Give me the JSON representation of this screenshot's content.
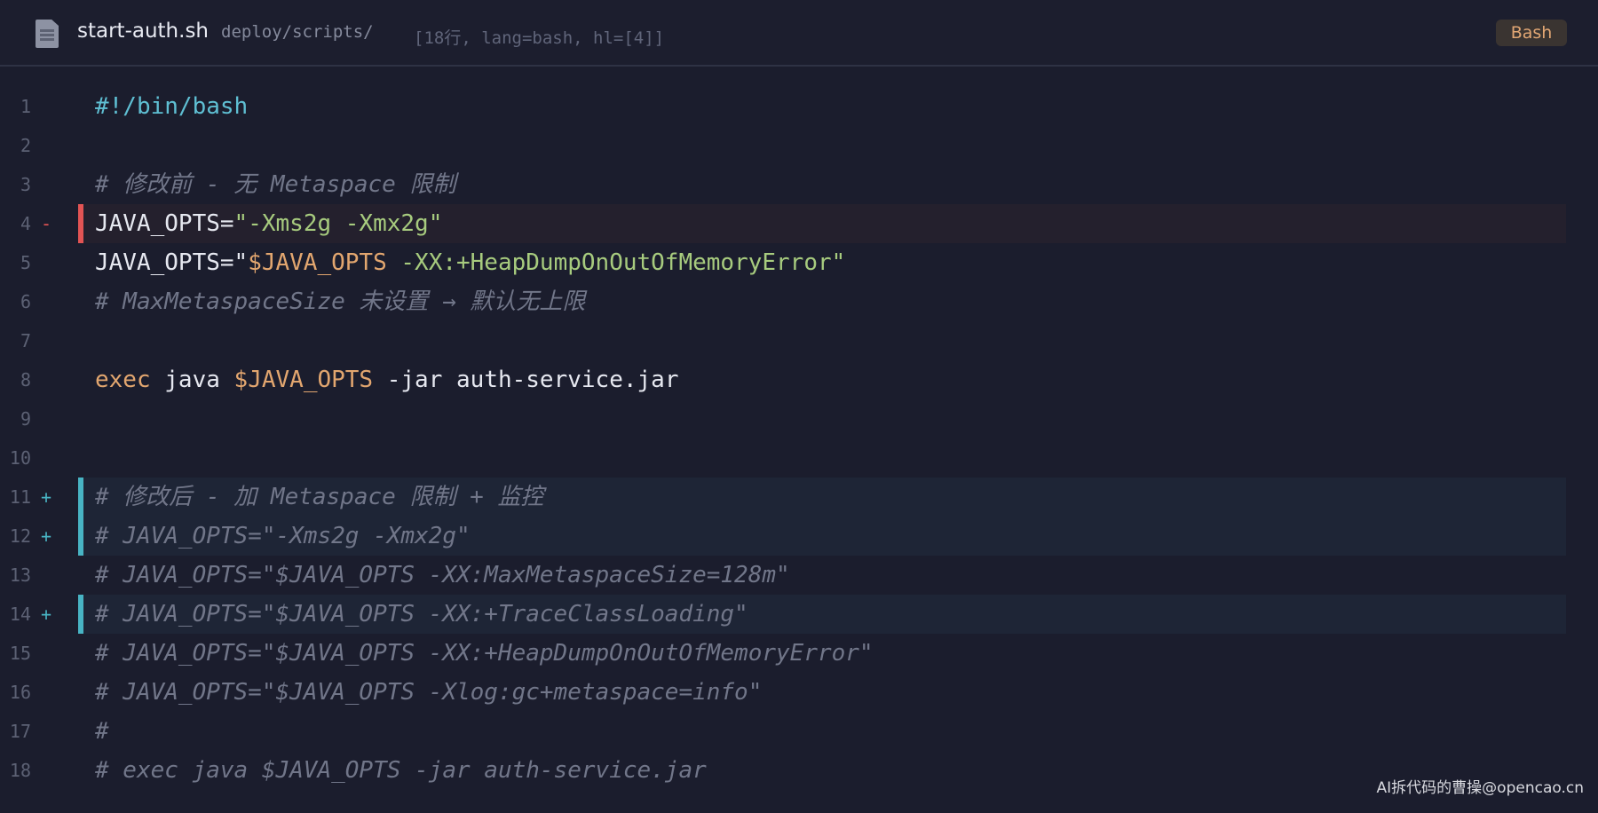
{
  "header": {
    "file_icon": "document-icon",
    "filename": "start-auth.sh",
    "path": "deploy/scripts/",
    "meta": "[18行, lang=bash, hl=[4]]",
    "language_badge": "Bash"
  },
  "colors": {
    "background": "#1b1d2d",
    "deleted_marker": "#e25454",
    "added_marker": "#48b4c4",
    "keyword": "#e2a66f",
    "string": "#a7cb7e",
    "comment": "#717689",
    "shebang": "#5fbfd3"
  },
  "lines": [
    {
      "num": "1",
      "mark": "",
      "text": "#!/bin/bash"
    },
    {
      "num": "2",
      "mark": "",
      "text": ""
    },
    {
      "num": "3",
      "mark": "",
      "text": "# 修改前 - 无 Metaspace 限制"
    },
    {
      "num": "4",
      "mark": "-",
      "text_a": "JAVA_OPTS=",
      "text_b": "\"-Xms2g -Xmx2g\""
    },
    {
      "num": "5",
      "mark": "",
      "text_a": "JAVA_OPTS=\"",
      "text_b": "$JAVA_OPTS",
      "text_c": " -XX:+HeapDumpOnOutOfMemoryError\""
    },
    {
      "num": "6",
      "mark": "",
      "text": "# MaxMetaspaceSize 未设置 → 默认无上限"
    },
    {
      "num": "7",
      "mark": "",
      "text": ""
    },
    {
      "num": "8",
      "mark": "",
      "text_a": "exec",
      "text_b": " java ",
      "text_c": "$JAVA_OPTS",
      "text_d": " -jar auth-service.jar"
    },
    {
      "num": "9",
      "mark": "",
      "text": ""
    },
    {
      "num": "10",
      "mark": "",
      "text": ""
    },
    {
      "num": "11",
      "mark": "+",
      "text": "# 修改后 - 加 Metaspace 限制 + 监控"
    },
    {
      "num": "12",
      "mark": "+",
      "text": "# JAVA_OPTS=\"-Xms2g -Xmx2g\""
    },
    {
      "num": "13",
      "mark": "",
      "text": "# JAVA_OPTS=\"$JAVA_OPTS -XX:MaxMetaspaceSize=128m\""
    },
    {
      "num": "14",
      "mark": "+",
      "text": "# JAVA_OPTS=\"$JAVA_OPTS -XX:+TraceClassLoading\""
    },
    {
      "num": "15",
      "mark": "",
      "text": "# JAVA_OPTS=\"$JAVA_OPTS -XX:+HeapDumpOnOutOfMemoryError\""
    },
    {
      "num": "16",
      "mark": "",
      "text": "# JAVA_OPTS=\"$JAVA_OPTS -Xlog:gc+metaspace=info\""
    },
    {
      "num": "17",
      "mark": "",
      "text": "#"
    },
    {
      "num": "18",
      "mark": "",
      "text": "# exec java $JAVA_OPTS -jar auth-service.jar"
    }
  ],
  "watermark": "AI拆代码的曹操@opencao.cn"
}
